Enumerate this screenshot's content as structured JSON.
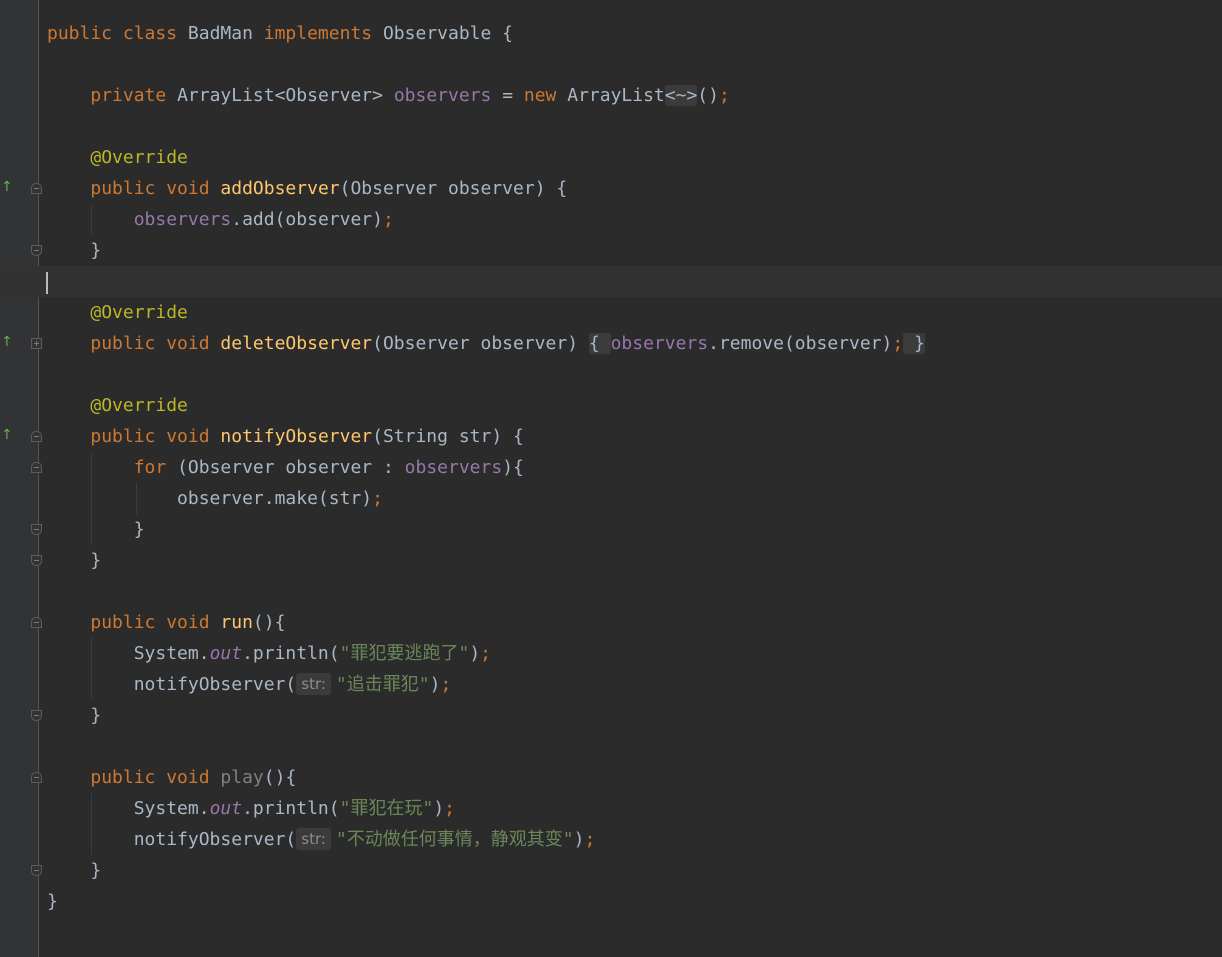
{
  "editor": {
    "lines": [
      {
        "tokens": [
          [
            "kw",
            "public class "
          ],
          [
            "",
            "BadMan "
          ],
          [
            "kw",
            "implements "
          ],
          [
            "",
            "Observable {"
          ]
        ]
      },
      {
        "tokens": []
      },
      {
        "tokens": [
          [
            "",
            "    "
          ],
          [
            "kw",
            "private "
          ],
          [
            "",
            "ArrayList<Observer> "
          ],
          [
            "fld",
            "observers"
          ],
          [
            "",
            " = "
          ],
          [
            "kw",
            "new "
          ],
          [
            "",
            "ArrayList"
          ],
          [
            "fold",
            "<~>"
          ],
          [
            "",
            "()"
          ],
          [
            "semi",
            ";"
          ]
        ]
      },
      {
        "tokens": []
      },
      {
        "tokens": [
          [
            "",
            "    "
          ],
          [
            "ann",
            "@Override"
          ]
        ]
      },
      {
        "tokens": [
          [
            "",
            "    "
          ],
          [
            "kw",
            "public void "
          ],
          [
            "fn",
            "addObserver"
          ],
          [
            "",
            "(Observer observer) {"
          ]
        ]
      },
      {
        "tokens": [
          [
            "",
            "        "
          ],
          [
            "fld",
            "observers"
          ],
          [
            "",
            ".add(observer)"
          ],
          [
            "semi",
            ";"
          ]
        ]
      },
      {
        "tokens": [
          [
            "",
            "    }"
          ]
        ]
      },
      {
        "tokens": [],
        "current": true
      },
      {
        "tokens": [
          [
            "",
            "    "
          ],
          [
            "ann",
            "@Override"
          ]
        ]
      },
      {
        "tokens": [
          [
            "",
            "    "
          ],
          [
            "kw",
            "public void "
          ],
          [
            "fn",
            "deleteObserver"
          ],
          [
            "",
            "(Observer observer) "
          ],
          [
            "fold",
            "{ "
          ],
          [
            "fld",
            "observers"
          ],
          [
            "",
            ".remove(observer)"
          ],
          [
            "semi",
            ";"
          ],
          [
            "fold",
            " }"
          ]
        ]
      },
      {
        "tokens": []
      },
      {
        "tokens": [
          [
            "",
            "    "
          ],
          [
            "ann",
            "@Override"
          ]
        ]
      },
      {
        "tokens": [
          [
            "",
            "    "
          ],
          [
            "kw",
            "public void "
          ],
          [
            "fn",
            "notifyObserver"
          ],
          [
            "",
            "(String str) {"
          ]
        ]
      },
      {
        "tokens": [
          [
            "",
            "        "
          ],
          [
            "kw",
            "for "
          ],
          [
            "",
            "(Observer observer : "
          ],
          [
            "fld",
            "observers"
          ],
          [
            "",
            "){"
          ]
        ]
      },
      {
        "tokens": [
          [
            "",
            "            observer.make(str)"
          ],
          [
            "semi",
            ";"
          ]
        ]
      },
      {
        "tokens": [
          [
            "",
            "        }"
          ]
        ]
      },
      {
        "tokens": [
          [
            "",
            "    }"
          ]
        ]
      },
      {
        "tokens": []
      },
      {
        "tokens": [
          [
            "",
            "    "
          ],
          [
            "kw",
            "public void "
          ],
          [
            "fn",
            "run"
          ],
          [
            "",
            "(){"
          ]
        ]
      },
      {
        "tokens": [
          [
            "",
            "        System."
          ],
          [
            "static",
            "out"
          ],
          [
            "",
            ".println("
          ],
          [
            "str",
            "\"罪犯要逃跑了\""
          ],
          [
            "",
            ")"
          ],
          [
            "semi",
            ";"
          ]
        ]
      },
      {
        "tokens": [
          [
            "",
            "        notifyObserver("
          ],
          [
            "hint",
            "str:"
          ],
          [
            "str",
            "\"追击罪犯\""
          ],
          [
            "",
            ")"
          ],
          [
            "semi",
            ";"
          ]
        ]
      },
      {
        "tokens": [
          [
            "",
            "    }"
          ]
        ]
      },
      {
        "tokens": []
      },
      {
        "tokens": [
          [
            "",
            "    "
          ],
          [
            "kw",
            "public void "
          ],
          [
            "unused",
            "play"
          ],
          [
            "",
            "(){"
          ]
        ]
      },
      {
        "tokens": [
          [
            "",
            "        System."
          ],
          [
            "static",
            "out"
          ],
          [
            "",
            ".println("
          ],
          [
            "str",
            "\"罪犯在玩\""
          ],
          [
            "",
            ")"
          ],
          [
            "semi",
            ";"
          ]
        ]
      },
      {
        "tokens": [
          [
            "",
            "        notifyObserver("
          ],
          [
            "hint",
            "str:"
          ],
          [
            "str",
            "\"不动做任何事情，静观其变\""
          ],
          [
            "",
            ")"
          ],
          [
            "semi",
            ";"
          ]
        ]
      },
      {
        "tokens": [
          [
            "",
            "    }"
          ]
        ]
      },
      {
        "tokens": [
          [
            "",
            "}"
          ]
        ]
      }
    ]
  },
  "gutter": {
    "implements_icons": [
      {
        "line": 5,
        "icon": "implements-method-icon"
      },
      {
        "line": 10,
        "icon": "implements-method-icon"
      },
      {
        "line": 13,
        "icon": "implements-method-icon"
      }
    ],
    "fold_marks": [
      {
        "line": 5,
        "kind": "start"
      },
      {
        "line": 7,
        "kind": "end"
      },
      {
        "line": 10,
        "kind": "plus"
      },
      {
        "line": 13,
        "kind": "start"
      },
      {
        "line": 14,
        "kind": "start"
      },
      {
        "line": 16,
        "kind": "end"
      },
      {
        "line": 17,
        "kind": "end"
      },
      {
        "line": 19,
        "kind": "start"
      },
      {
        "line": 22,
        "kind": "end"
      },
      {
        "line": 24,
        "kind": "start"
      },
      {
        "line": 27,
        "kind": "end"
      }
    ]
  },
  "colors": {
    "background": "#2b2b2b",
    "keyword": "#cc7832",
    "annotation": "#bbb529",
    "method": "#ffc66d",
    "field": "#9876aa",
    "string": "#6a8759",
    "text": "#a9b7c6"
  }
}
